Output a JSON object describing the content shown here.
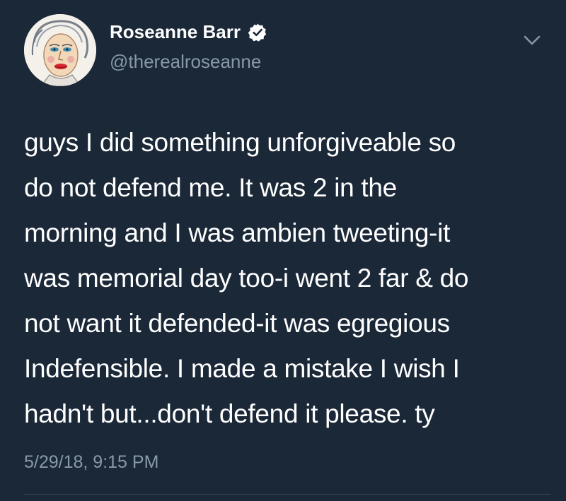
{
  "author": {
    "name": "Roseanne Barr",
    "handle": "@therealroseanne",
    "verified_icon": "verified-badge-icon",
    "avatar_icon": "avatar-portrait"
  },
  "menu": {
    "icon": "chevron-down-icon"
  },
  "tweet": {
    "lines": [
      "guys I did something unforgiveable so",
      "do not defend me. It was 2 in the",
      "morning and I was ambien tweeting-it",
      "was memorial day too-i went 2 far & do",
      "not want it defended-it was egregious",
      "Indefensible. I made a mistake I wish I",
      "hadn't but...don't defend it please. ty"
    ],
    "timestamp": "5/29/18, 9:15 PM"
  },
  "colors": {
    "background": "#1b2838",
    "text": "#ffffff",
    "secondary_text": "#8899a6",
    "divider": "#38444d"
  }
}
